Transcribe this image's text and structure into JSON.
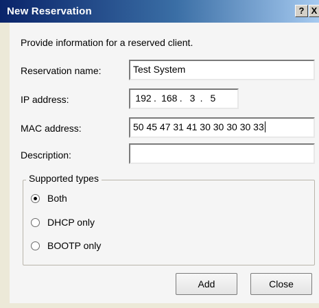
{
  "window": {
    "title": "New Reservation",
    "help_button": "?",
    "close_button": "X"
  },
  "instruction": "Provide information for a reserved client.",
  "fields": {
    "reservation_name": {
      "label": "Reservation name:",
      "value": "Test System"
    },
    "ip_address": {
      "label": "IP address:",
      "octets": [
        "192",
        "168",
        "3",
        "5"
      ]
    },
    "mac_address": {
      "label": "MAC address:",
      "value": "50 45 47 31 41 30 30 30 30 33"
    },
    "description": {
      "label": "Description:",
      "value": ""
    }
  },
  "supported_types": {
    "legend": "Supported types",
    "options": [
      {
        "label": "Both",
        "checked": true
      },
      {
        "label": "DHCP only",
        "checked": false
      },
      {
        "label": "BOOTP only",
        "checked": false
      }
    ]
  },
  "buttons": {
    "add": "Add",
    "close": "Close"
  }
}
